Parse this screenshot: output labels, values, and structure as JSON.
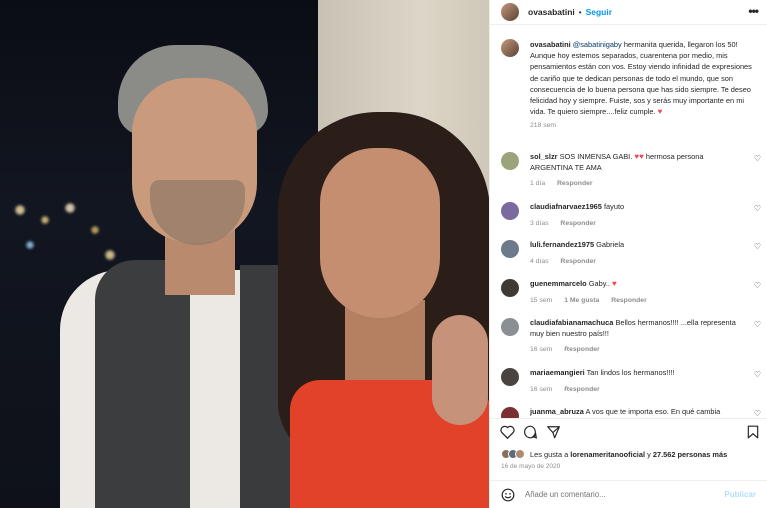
{
  "header": {
    "username": "ovasabatini",
    "separator": "•",
    "follow_label": "Seguir",
    "more_label": "•••"
  },
  "caption": {
    "username": "ovasabatini",
    "mention": "@sabatinigaby",
    "text": "hermanita querida, llegaron los 50! Aunque hoy estemos separados, cuarentena por medio, mis pensamientos están con vos. Estoy viendo infinidad de expresiones de cariño que te dedican personas de todo el mundo, que son consecuencia de lo buena persona que has sido siempre. Te deseo felicidad hoy y siempre. Fuiste, sos y serás muy importante en mi vida. Te quiero siempre....feliz cumple.",
    "heart": "♥",
    "time": "218 sem"
  },
  "comments": [
    {
      "user": "sol_slzr",
      "text": "SOS INMENSA GABI.",
      "hearts": "♥♥",
      "text2": "hermosa persona ARGENTINA TE AMA",
      "time": "1 día",
      "likes": "",
      "reply": "Responder",
      "avatar_color": "#9aa37a"
    },
    {
      "user": "claudiafnarvaez1965",
      "text": "fayuto",
      "hearts": "",
      "text2": "",
      "time": "3 días",
      "likes": "",
      "reply": "Responder",
      "avatar_color": "#7a6aa0"
    },
    {
      "user": "luli.fernandez1975",
      "text": "Gabriela",
      "hearts": "",
      "text2": "",
      "time": "4 días",
      "likes": "",
      "reply": "Responder",
      "avatar_color": "#6c7a8c"
    },
    {
      "user": "guenemmarcelo",
      "text": "Gaby..",
      "hearts": "♥",
      "text2": "",
      "time": "15 sem",
      "likes": "1 Me gusta",
      "reply": "Responder",
      "avatar_color": "#3e3a36"
    },
    {
      "user": "claudiafabianamachuca",
      "text": "Bellos hermanos!!!! ...ella representa muy bien nuestro país!!!",
      "hearts": "",
      "text2": "",
      "time": "16 sem",
      "likes": "",
      "reply": "Responder",
      "avatar_color": "#8a8f96"
    },
    {
      "user": "mariaemangieri",
      "text": "Tan lindos los hermanos!!!!",
      "hearts": "",
      "text2": "",
      "time": "16 sem",
      "likes": "",
      "reply": "Responder",
      "avatar_color": "#4a4440"
    },
    {
      "user": "juanma_abruza",
      "text": "A vos que te importa eso. En qué cambia",
      "hearts": "",
      "text2": "",
      "time": "",
      "likes": "",
      "reply": "",
      "avatar_color": "#7a3030"
    }
  ],
  "icons": {
    "like": "heart-icon",
    "comment": "comment-icon",
    "share": "share-icon",
    "save": "bookmark-icon",
    "emoji": "emoji-icon"
  },
  "likes": {
    "prefix": "Les gusta a",
    "user": "lorenameritanooficial",
    "middle": "y",
    "count": "27.562 personas más"
  },
  "date": "16 de mayo de 2020",
  "add_comment": {
    "placeholder": "Añade un comentario...",
    "post_label": "Publicar"
  },
  "colors": {
    "accent": "#0095f6",
    "heart": "#ed4956",
    "secondary_text": "#8e8e8e"
  }
}
